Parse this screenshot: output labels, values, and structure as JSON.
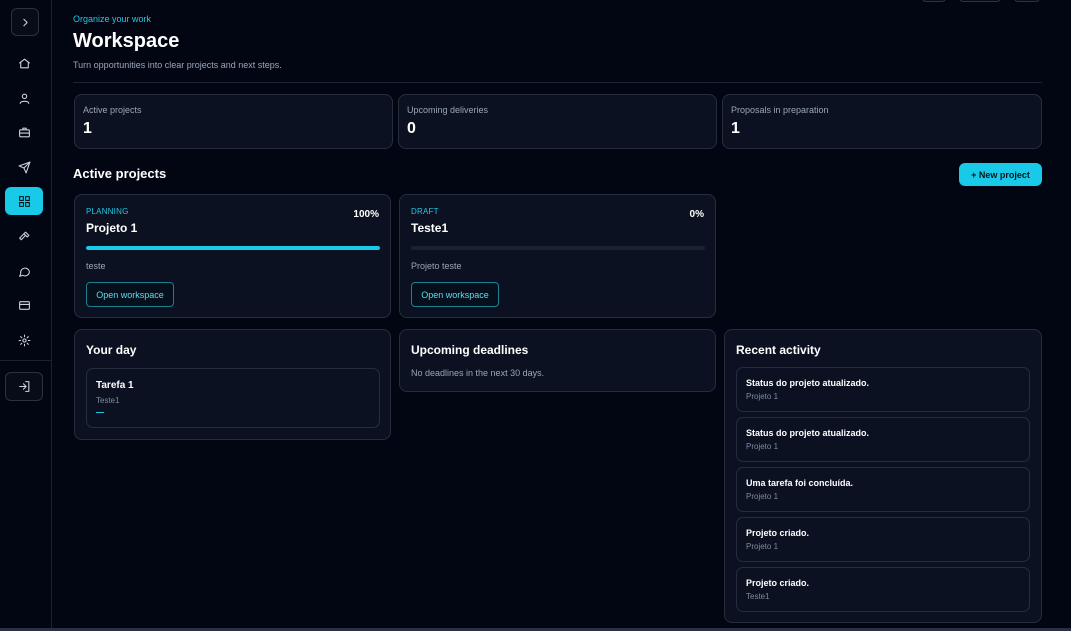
{
  "header": {
    "kicker": "Organize your work",
    "title": "Workspace",
    "subtitle": "Turn opportunities into clear projects and next steps."
  },
  "sidebar": {
    "items": [
      {
        "icon": "chevron-right-icon"
      },
      {
        "icon": "home-icon"
      },
      {
        "icon": "user-icon"
      },
      {
        "icon": "briefcase-icon"
      },
      {
        "icon": "send-icon"
      },
      {
        "icon": "grid-icon",
        "active": true
      },
      {
        "icon": "hammer-icon"
      },
      {
        "icon": "message-icon"
      },
      {
        "icon": "card-icon"
      },
      {
        "icon": "gear-icon"
      },
      {
        "icon": "logout-icon"
      }
    ]
  },
  "stats": [
    {
      "label": "Active projects",
      "value": "1"
    },
    {
      "label": "Upcoming deliveries",
      "value": "0"
    },
    {
      "label": "Proposals in preparation",
      "value": "1"
    }
  ],
  "projects_section": {
    "title": "Active projects",
    "new_button": "+ New project"
  },
  "projects": [
    {
      "status": "PLANNING",
      "name": "Projeto 1",
      "percent_label": "100%",
      "progress": 1.0,
      "description": "teste",
      "open_label": "Open workspace"
    },
    {
      "status": "DRAFT",
      "name": "Teste1",
      "percent_label": "0%",
      "progress": 0.0,
      "description": "Projeto teste",
      "open_label": "Open workspace"
    }
  ],
  "your_day": {
    "title": "Your day",
    "task": {
      "title": "Tarefa 1",
      "project": "Teste1"
    }
  },
  "deadlines": {
    "title": "Upcoming deadlines",
    "empty": "No deadlines in the next 30 days."
  },
  "recent_activity": {
    "title": "Recent activity",
    "items": [
      {
        "text": "Status do projeto atualizado.",
        "project": "Projeto 1"
      },
      {
        "text": "Status do projeto atualizado.",
        "project": "Projeto 1"
      },
      {
        "text": "Uma tarefa foi concluída.",
        "project": "Projeto 1"
      },
      {
        "text": "Projeto criado.",
        "project": "Projeto 1"
      },
      {
        "text": "Projeto criado.",
        "project": "Teste1"
      }
    ]
  },
  "colors": {
    "accent": "#18c9e8",
    "background": "#020613",
    "card": "#0b1120"
  }
}
